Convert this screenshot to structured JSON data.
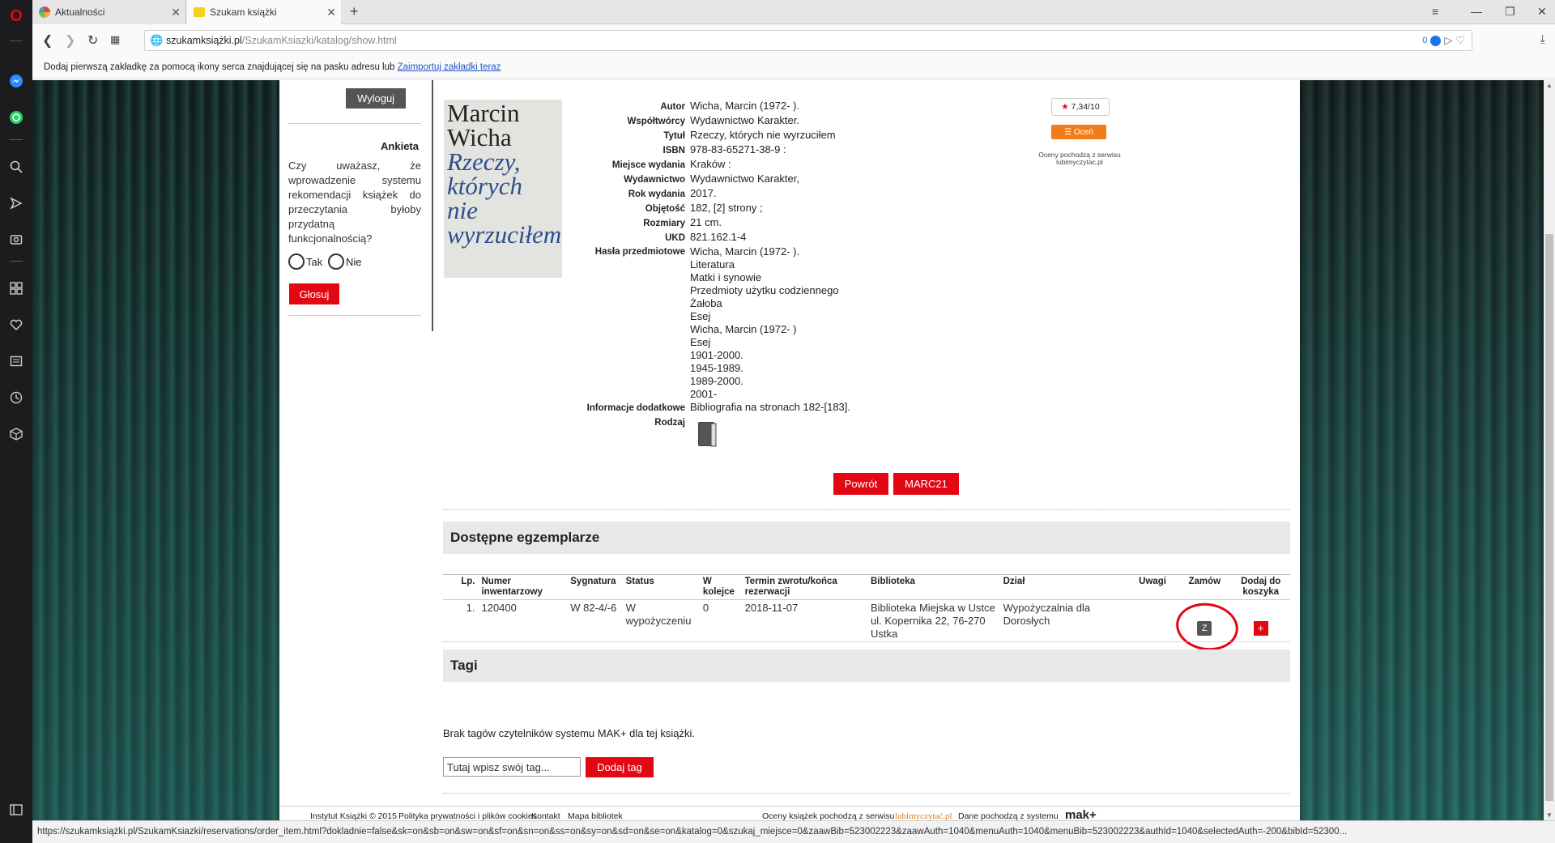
{
  "browser": {
    "tabs": [
      {
        "title": "Aktualności"
      },
      {
        "title": "Szukam książki"
      }
    ],
    "url_host": "szukamksiążki.pl",
    "url_path": "/SzukamKsiazki/katalog/show.html",
    "adblock_count": "0",
    "bookmark_hint": "Dodaj pierwszą zakładkę za pomocą ikony serca znajdującej się na pasku adresu lub",
    "bookmark_link": "Zaimportuj zakładki teraz",
    "status_url": "https://szukamksiążki.pl/SzukamKsiazki/reservations/order_item.html?dokladnie=false&sk=on&sb=on&sw=on&sf=on&sn=on&ss=on&sy=on&sd=on&se=on&katalog=0&szukaj_miejsce=0&zaawBib=523002223&zaawAuth=1040&menuAuth=1040&menuBib=523002223&authId=1040&selectedAuth=-200&bibId=52300..."
  },
  "sidebar": {
    "logout": "Wyloguj",
    "survey_title": "Ankieta",
    "survey_question": "Czy uważasz, że wprowadzenie systemu rekomendacji książek do przeczytania byłoby przydatną funkcjonalnością?",
    "option_yes": "Tak",
    "option_no": "Nie",
    "vote": "Głosuj"
  },
  "cover": {
    "author_line1": "Marcin",
    "author_line2": "Wicha",
    "title_line1": "Rzeczy,",
    "title_line2": "których",
    "title_line3": "nie",
    "title_line4": "wyrzuciłem"
  },
  "book": {
    "fields": [
      {
        "label": "Autor",
        "values": [
          "Wicha, Marcin (1972- )."
        ]
      },
      {
        "label": "Współtwórcy",
        "values": [
          "Wydawnictwo Karakter."
        ]
      },
      {
        "label": "Tytuł",
        "values": [
          "Rzeczy, których nie wyrzuciłem"
        ]
      },
      {
        "label": "ISBN",
        "values": [
          "978-83-65271-38-9 :"
        ]
      },
      {
        "label": "Miejsce wydania",
        "values": [
          "Kraków :"
        ]
      },
      {
        "label": "Wydawnictwo",
        "values": [
          "Wydawnictwo Karakter,"
        ]
      },
      {
        "label": "Rok wydania",
        "values": [
          "2017."
        ]
      },
      {
        "label": "Objętość",
        "values": [
          "182, [2] strony ;"
        ]
      },
      {
        "label": "Rozmiary",
        "values": [
          "21 cm."
        ]
      },
      {
        "label": "UKD",
        "values": [
          "821.162.1-4"
        ]
      },
      {
        "label": "Hasła przedmiotowe",
        "values": [
          "Wicha, Marcin (1972- ).",
          "Literatura",
          "Matki i synowie",
          "Przedmioty użytku codziennego",
          "Żałoba",
          "Esej",
          "Wicha, Marcin (1972- )",
          "Esej",
          "1901-2000.",
          "1945-1989.",
          "1989-2000.",
          "2001-"
        ]
      },
      {
        "label": "Informacje dodatkowe",
        "values": [
          "Bibliografia na stronach 182-[183]."
        ]
      },
      {
        "label": "Rodzaj",
        "values": []
      }
    ],
    "rating": "7,34/10",
    "rate_btn": "Oceń",
    "rating_note": "Oceny pochodzą z serwisu lubimyczytac.pl",
    "back_btn": "Powrót",
    "marc_btn": "MARC21"
  },
  "copies": {
    "heading": "Dostępne egzemplarze",
    "columns": [
      "Lp.",
      "Numer inwentarzowy",
      "Sygnatura",
      "Status",
      "W kolejce",
      "Termin zwrotu/końca rezerwacji",
      "Biblioteka",
      "Dział",
      "Uwagi",
      "Zamów",
      "Dodaj do koszyka"
    ],
    "rows": [
      {
        "lp": "1.",
        "inv": "120400",
        "sig": "W 82-4/-6",
        "status": "W wypożyczeniu",
        "queue": "0",
        "due": "2018-11-07",
        "lib": "Biblioteka Miejska w Ustce",
        "lib_addr": "ul. Kopernika 22, 76-270 Ustka",
        "dept": "Wypożyczalnia dla Dorosłych",
        "notes": "",
        "order": "Z",
        "cart": "+"
      }
    ]
  },
  "tags": {
    "heading": "Tagi",
    "empty": "Brak tagów czytelników systemu MAK+ dla tej książki.",
    "placeholder": "Tutaj wpisz swój tag...",
    "add_btn": "Dodaj tag"
  },
  "footer": {
    "org": "Instytut Książki © 2015",
    "privacy": "Polityka prywatności i plików cookies",
    "contact": "Kontakt",
    "map": "Mapa bibliotek",
    "ratings_source": "Oceny książek pochodzą z serwisu",
    "ratings_logo": "lubimyczytać.pl",
    "data_source": "Dane pochodzą z systemu",
    "data_logo": "mak+"
  }
}
